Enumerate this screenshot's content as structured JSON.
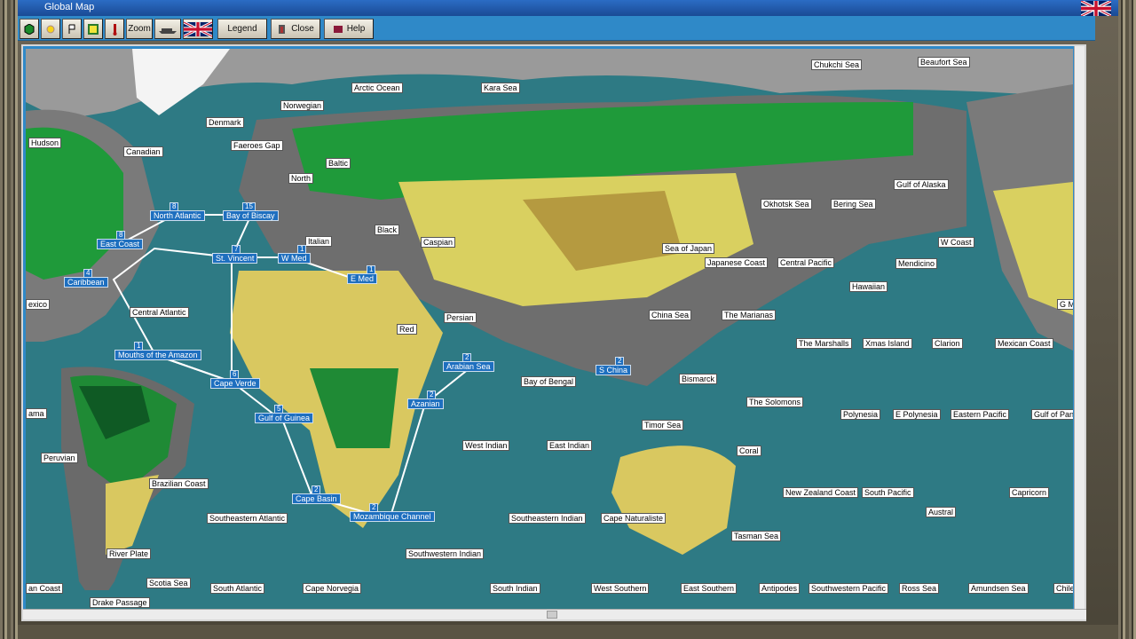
{
  "window": {
    "title": "Global Map"
  },
  "toolbar": {
    "zoom_label": "Zoom",
    "legend_label": "Legend",
    "close_label": "Close",
    "help_label": "Help"
  },
  "regions": [
    {
      "name": "Chukchi Sea"
    },
    {
      "name": "Beaufort Sea"
    },
    {
      "name": "Kara Sea"
    },
    {
      "name": "Arctic Ocean"
    },
    {
      "name": "Norwegian"
    },
    {
      "name": "Denmark"
    },
    {
      "name": "Hudson"
    },
    {
      "name": "Canadian"
    },
    {
      "name": "Faeroes Gap"
    },
    {
      "name": "Baltic"
    },
    {
      "name": "North"
    },
    {
      "name": "Gulf of Alaska"
    },
    {
      "name": "Okhotsk Sea"
    },
    {
      "name": "Bering Sea"
    },
    {
      "name": "W Coast"
    },
    {
      "name": "Italian"
    },
    {
      "name": "Black"
    },
    {
      "name": "Caspian"
    },
    {
      "name": "Sea of Japan"
    },
    {
      "name": "Japanese Coast"
    },
    {
      "name": "Central Pacific"
    },
    {
      "name": "Mendicino"
    },
    {
      "name": "exico"
    },
    {
      "name": "Hawaiian"
    },
    {
      "name": "Central Atlantic"
    },
    {
      "name": "Persian"
    },
    {
      "name": "China Sea"
    },
    {
      "name": "The Marianas"
    },
    {
      "name": "G M"
    },
    {
      "name": "Red"
    },
    {
      "name": "The Marshalls"
    },
    {
      "name": "Xmas Island"
    },
    {
      "name": "Clarion"
    },
    {
      "name": "Mexican Coast"
    },
    {
      "name": "Bay of Bengal"
    },
    {
      "name": "Bismarck"
    },
    {
      "name": "The Solomons"
    },
    {
      "name": "ama"
    },
    {
      "name": "Polynesia"
    },
    {
      "name": "E Polynesia"
    },
    {
      "name": "Eastern Pacific"
    },
    {
      "name": "Gulf of Pan"
    },
    {
      "name": "Timor Sea"
    },
    {
      "name": "West Indian"
    },
    {
      "name": "East Indian"
    },
    {
      "name": "Peruvian"
    },
    {
      "name": "Coral"
    },
    {
      "name": "Brazilian Coast"
    },
    {
      "name": "New Zealand Coast"
    },
    {
      "name": "South Pacific"
    },
    {
      "name": "Capricorn"
    },
    {
      "name": "Australia"
    },
    {
      "name": "Southeastern Atlantic"
    },
    {
      "name": "Southeastern Indian"
    },
    {
      "name": "Cape Naturaliste"
    },
    {
      "name": "Austral"
    },
    {
      "name": "River Plate"
    },
    {
      "name": "Southwestern Indian"
    },
    {
      "name": "Tasman Sea"
    },
    {
      "name": "Scotia Sea"
    },
    {
      "name": "an Coast"
    },
    {
      "name": "South Atlantic"
    },
    {
      "name": "Cape Norvegia"
    },
    {
      "name": "South Indian"
    },
    {
      "name": "West Southern"
    },
    {
      "name": "East Southern"
    },
    {
      "name": "Antipodes"
    },
    {
      "name": "Southwestern Pacific"
    },
    {
      "name": "Ross Sea"
    },
    {
      "name": "Amundsen Sea"
    },
    {
      "name": "Chile"
    },
    {
      "name": "Drake Passage"
    }
  ],
  "routes": [
    {
      "name": "North Atlantic",
      "count": "8"
    },
    {
      "name": "Bay of Biscay",
      "count": "15"
    },
    {
      "name": "East Coast",
      "count": "8"
    },
    {
      "name": "St. Vincent",
      "count": "7"
    },
    {
      "name": "W Med",
      "count": "1"
    },
    {
      "name": "E Med",
      "count": "1"
    },
    {
      "name": "Caribbean",
      "count": "4"
    },
    {
      "name": "Mouths of the Amazon",
      "count": "1"
    },
    {
      "name": "Cape Verde",
      "count": "6"
    },
    {
      "name": "Gulf of Guinea",
      "count": "5"
    },
    {
      "name": "Arabian Sea",
      "count": "2"
    },
    {
      "name": "S China",
      "count": "2"
    },
    {
      "name": "Azanian",
      "count": "2"
    },
    {
      "name": "Cape Basin",
      "count": "2"
    },
    {
      "name": "Mozambique Channel",
      "count": "2"
    }
  ]
}
